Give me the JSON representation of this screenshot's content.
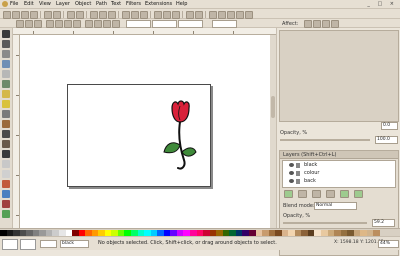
{
  "menubar": {
    "items": [
      "File",
      "Edit",
      "View",
      "Layer",
      "Object",
      "Path",
      "Text",
      "Filters",
      "Extensions",
      "Help"
    ],
    "window_buttons": "_ □ ×"
  },
  "ctrlbar": {
    "affect_label": "Affect:"
  },
  "dock": {
    "opacity_label": "Opacity, %",
    "opacity_value": "100.0",
    "value_box": "0.0",
    "layers_title": "Layers (Shift+Ctrl+L)",
    "layers": [
      {
        "name": "black"
      },
      {
        "name": "colour"
      },
      {
        "name": "back"
      }
    ],
    "blend_label": "Blend mode:",
    "blend_value": "Normal",
    "layer_opacity_label": "Opacity, %",
    "layer_opacity_value": "59.2"
  },
  "status": {
    "message": "No objects selected. Click, Shift+click, or drag around objects to select.",
    "layer_value": "black",
    "coords": "X: 1598.18  Y: 1201.82",
    "zoom": "44%"
  },
  "palette": {
    "colors": [
      "#000000",
      "#1a1a1a",
      "#333333",
      "#4d4d4d",
      "#666666",
      "#808080",
      "#999999",
      "#b3b3b3",
      "#cccccc",
      "#e6e6e6",
      "#ffffff",
      "#800000",
      "#ff0000",
      "#ff6600",
      "#ff9900",
      "#ffcc00",
      "#ffff00",
      "#ccff00",
      "#66ff00",
      "#00ff00",
      "#00ff66",
      "#00ffcc",
      "#00ffff",
      "#00ccff",
      "#0066ff",
      "#0000ff",
      "#6600ff",
      "#cc00ff",
      "#ff00ff",
      "#ff0099",
      "#ff0066",
      "#cc0033",
      "#993300",
      "#996600",
      "#336600",
      "#006633",
      "#003366",
      "#330066",
      "#660033",
      "#e6c3a1",
      "#c89b6d",
      "#a0703f",
      "#7a4a20",
      "#d9b38c",
      "#f2d5b0",
      "#b38b5d",
      "#8c6239",
      "#5c3d1e",
      "#f5e1c8",
      "#e8c9a0",
      "#ccaa7a",
      "#b08655",
      "#947040",
      "#7a5a30",
      "#c7a57a",
      "#deb887",
      "#d2b48c",
      "#bc8f5f"
    ]
  }
}
